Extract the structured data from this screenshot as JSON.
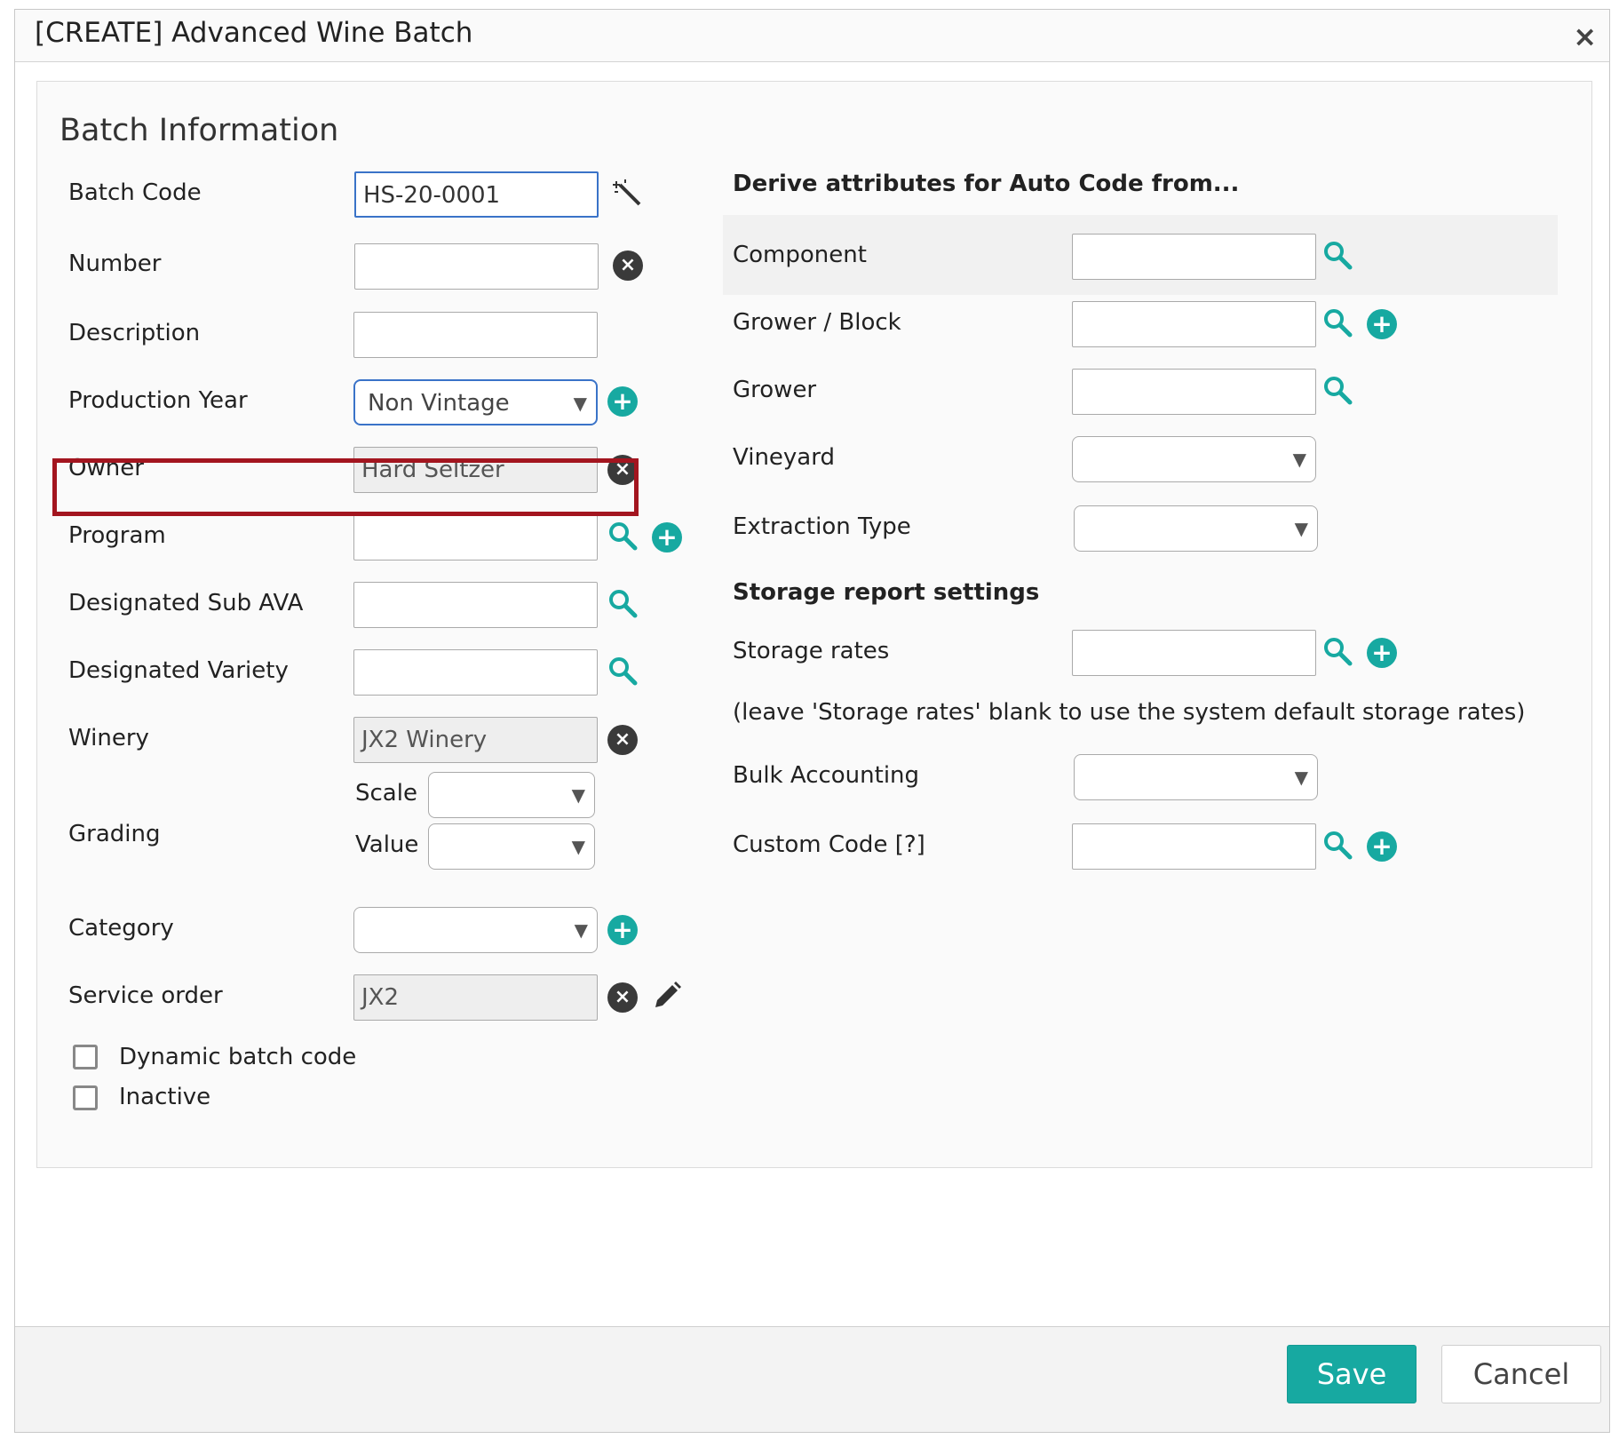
{
  "window": {
    "title": "[CREATE] Advanced Wine Batch",
    "close_label": "×"
  },
  "section": {
    "title": "Batch Information"
  },
  "left_form": {
    "batch_code": {
      "label": "Batch Code",
      "value": "HS-20-0001"
    },
    "number": {
      "label": "Number",
      "value": ""
    },
    "description": {
      "label": "Description",
      "value": ""
    },
    "production_year": {
      "label": "Production Year",
      "value": "Non Vintage"
    },
    "owner": {
      "label": "Owner",
      "value": "Hard Seltzer"
    },
    "program": {
      "label": "Program",
      "value": ""
    },
    "designated_sub_ava": {
      "label": "Designated Sub AVA",
      "value": ""
    },
    "designated_variety": {
      "label": "Designated Variety",
      "value": ""
    },
    "winery": {
      "label": "Winery",
      "value": "JX2 Winery"
    },
    "grading": {
      "label": "Grading",
      "scale_label": "Scale",
      "value_label": "Value"
    },
    "category": {
      "label": "Category",
      "value": ""
    },
    "service_order": {
      "label": "Service order",
      "value": "JX2"
    },
    "dynamic_batch_code": {
      "label": "Dynamic batch code",
      "checked": false
    },
    "inactive": {
      "label": "Inactive",
      "checked": false
    }
  },
  "right_form": {
    "derive_heading": "Derive attributes for Auto Code from...",
    "component": {
      "label": "Component",
      "value": ""
    },
    "grower_block": {
      "label": "Grower / Block",
      "value": ""
    },
    "grower": {
      "label": "Grower",
      "value": ""
    },
    "vineyard": {
      "label": "Vineyard",
      "value": ""
    },
    "extraction_type": {
      "label": "Extraction Type",
      "value": ""
    },
    "storage_heading": "Storage report settings",
    "storage_rates": {
      "label": "Storage rates",
      "value": ""
    },
    "storage_note": "(leave 'Storage rates' blank to use the system default storage rates)",
    "bulk_accounting": {
      "label": "Bulk Accounting",
      "value": ""
    },
    "custom_code": {
      "label": "Custom Code [?]",
      "value": ""
    }
  },
  "footer": {
    "save_label": "Save",
    "cancel_label": "Cancel"
  },
  "colors": {
    "accent": "#17a9a1",
    "highlight": "#a3151f",
    "focus": "#3a73c8"
  },
  "icons": [
    "magic-wand-icon",
    "clear-icon",
    "add-icon",
    "search-icon",
    "edit-pencil-icon",
    "close-icon",
    "dropdown-arrow-icon"
  ]
}
